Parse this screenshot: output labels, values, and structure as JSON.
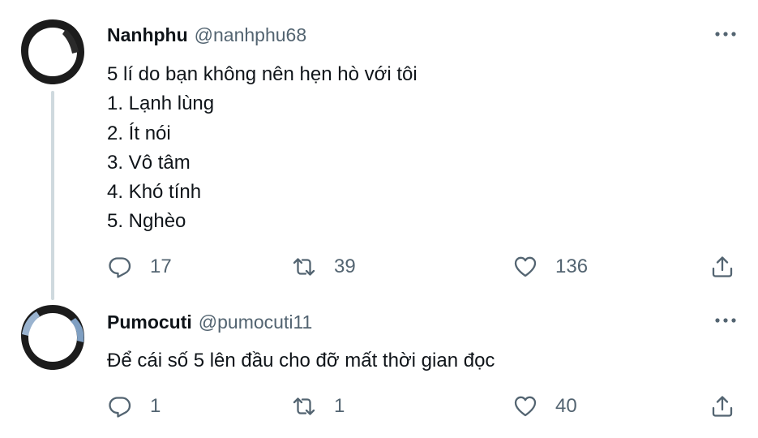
{
  "tweets": [
    {
      "display_name": "Nanhphu",
      "handle": "@nanhphu68",
      "lines": [
        "5 lí do bạn không nên hẹn hò với tôi",
        "1. Lạnh lùng",
        "2. Ít nói",
        "3. Vô tâm",
        "4. Khó tính",
        "5. Nghèo"
      ],
      "replies": "17",
      "retweets": "39",
      "likes": "136"
    },
    {
      "display_name": "Pumocuti",
      "handle": "@pumocuti11",
      "lines": [
        "Để cái số 5 lên đầu cho đỡ mất thời gian đọc"
      ],
      "replies": "1",
      "retweets": "1",
      "likes": "40"
    }
  ],
  "icons": {
    "reply": "reply-icon",
    "retweet": "retweet-icon",
    "like": "heart-icon",
    "share": "share-icon",
    "more": "more-icon"
  },
  "colors": {
    "text": "#0f1419",
    "secondary": "#536471",
    "thread_line": "#cfd9de"
  }
}
